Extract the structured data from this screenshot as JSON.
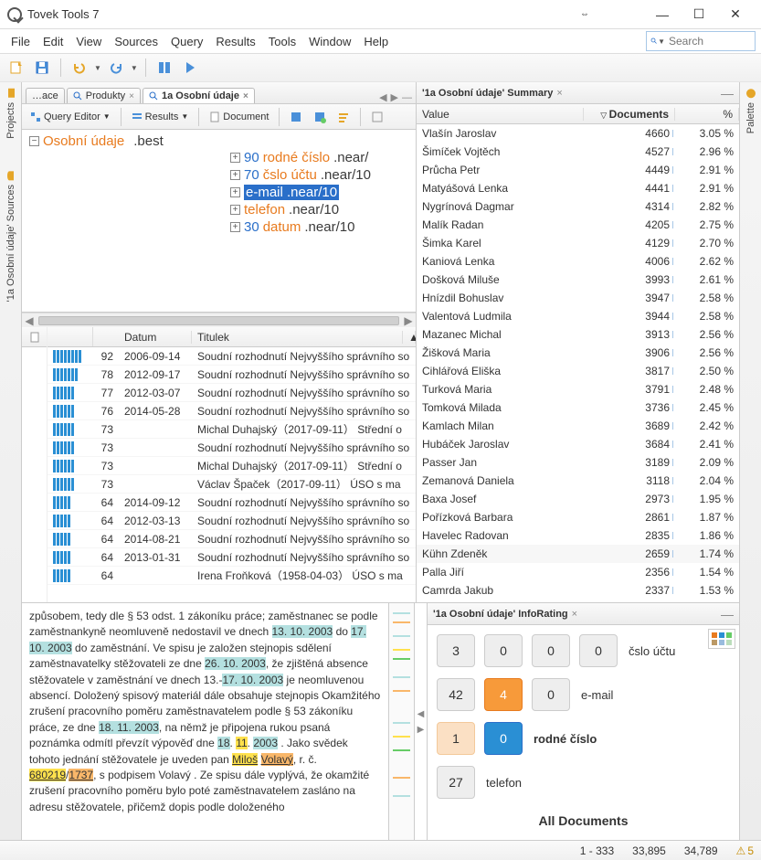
{
  "app": {
    "title": "Tovek Tools 7"
  },
  "menu": {
    "file": "File",
    "edit": "Edit",
    "view": "View",
    "sources": "Sources",
    "query": "Query",
    "results": "Results",
    "tools": "Tools",
    "window": "Window",
    "help": "Help"
  },
  "search": {
    "placeholder": "Search"
  },
  "leftTabs": {
    "projects": "Projects",
    "sources": "'1a Osobní údaje' Sources"
  },
  "rightTabs": {
    "palette": "Palette"
  },
  "editorTabs": {
    "t1": "…ace",
    "t2": "Produkty",
    "t3": "1a Osobní údaje"
  },
  "queryTools": {
    "editor": "Query Editor",
    "results": "Results",
    "document": "Document"
  },
  "tree": {
    "root_l": "Osobní údaje",
    "root_op": ".best",
    "c1_n": "90",
    "c1_l": "rodné číslo",
    "c1_op": ".near/",
    "c2_n": "70",
    "c2_l": "čslo účtu",
    "c2_op": ".near/10",
    "c3_l": "e-mail .near/10",
    "c4_l": "telefon",
    "c4_op": ".near/10",
    "c5_n": "30",
    "c5_l": "datum",
    "c5_op": ".near/10"
  },
  "resultHeaders": {
    "date": "Datum",
    "title": "Titulek"
  },
  "results": [
    {
      "n": "92",
      "d": "2006-09-14",
      "t": "Soudní rozhodnutí Nejvyššího správního so"
    },
    {
      "n": "78",
      "d": "2012-09-17",
      "t": "Soudní rozhodnutí Nejvyššího správního so"
    },
    {
      "n": "77",
      "d": "2012-03-07",
      "t": "Soudní rozhodnutí Nejvyššího správního so"
    },
    {
      "n": "76",
      "d": "2014-05-28",
      "t": "Soudní rozhodnutí Nejvyššího správního so"
    },
    {
      "n": "73",
      "d": "",
      "t": "Michal Duhajský（2017-09-11） Střední o"
    },
    {
      "n": "73",
      "d": "",
      "t": "Soudní rozhodnutí Nejvyššího správního so"
    },
    {
      "n": "73",
      "d": "",
      "t": "Michal Duhajský（2017-09-11） Střední o"
    },
    {
      "n": "73",
      "d": "",
      "t": "Václav Špaček（2017-09-11） ÚSO s ma"
    },
    {
      "n": "64",
      "d": "2014-09-12",
      "t": "Soudní rozhodnutí Nejvyššího správního so"
    },
    {
      "n": "64",
      "d": "2012-03-13",
      "t": "Soudní rozhodnutí Nejvyššího správního so"
    },
    {
      "n": "64",
      "d": "2014-08-21",
      "t": "Soudní rozhodnutí Nejvyššího správního so"
    },
    {
      "n": "64",
      "d": "2013-01-31",
      "t": "Soudní rozhodnutí Nejvyššího správního so"
    },
    {
      "n": "64",
      "d": "",
      "t": "Irena Froňková（1958-04-03） ÚSO s ma"
    }
  ],
  "summary": {
    "title": "'1a Osobní údaje' Summary",
    "headers": {
      "value": "Value",
      "documents": "Documents",
      "percent": "%"
    },
    "rows": [
      {
        "v": "Vlašín Jaroslav",
        "d": "4660",
        "p": "3.05 %"
      },
      {
        "v": "Šimíček Vojtěch",
        "d": "4527",
        "p": "2.96 %"
      },
      {
        "v": "Průcha Petr",
        "d": "4449",
        "p": "2.91 %"
      },
      {
        "v": "Matyášová Lenka",
        "d": "4441",
        "p": "2.91 %"
      },
      {
        "v": "Nygrínová Dagmar",
        "d": "4314",
        "p": "2.82 %"
      },
      {
        "v": "Malík Radan",
        "d": "4205",
        "p": "2.75 %"
      },
      {
        "v": "Šimka Karel",
        "d": "4129",
        "p": "2.70 %"
      },
      {
        "v": "Kaniová Lenka",
        "d": "4006",
        "p": "2.62 %"
      },
      {
        "v": "Došková Miluše",
        "d": "3993",
        "p": "2.61 %"
      },
      {
        "v": "Hnízdil Bohuslav",
        "d": "3947",
        "p": "2.58 %"
      },
      {
        "v": "Valentová Ludmila",
        "d": "3944",
        "p": "2.58 %"
      },
      {
        "v": "Mazanec Michal",
        "d": "3913",
        "p": "2.56 %"
      },
      {
        "v": "Žišková Maria",
        "d": "3906",
        "p": "2.56 %"
      },
      {
        "v": "Cihlářová Eliška",
        "d": "3817",
        "p": "2.50 %"
      },
      {
        "v": "Turková Maria",
        "d": "3791",
        "p": "2.48 %"
      },
      {
        "v": "Tomková Milada",
        "d": "3736",
        "p": "2.45 %"
      },
      {
        "v": "Kamlach Milan",
        "d": "3689",
        "p": "2.42 %"
      },
      {
        "v": "Hubáček Jaroslav",
        "d": "3684",
        "p": "2.41 %"
      },
      {
        "v": "Passer Jan",
        "d": "3189",
        "p": "2.09 %"
      },
      {
        "v": "Zemanová Daniela",
        "d": "3118",
        "p": "2.04 %"
      },
      {
        "v": "Baxa Josef",
        "d": "2973",
        "p": "1.95 %"
      },
      {
        "v": "Pořízková Barbara",
        "d": "2861",
        "p": "1.87 %"
      },
      {
        "v": "Havelec Radovan",
        "d": "2835",
        "p": "1.86 %"
      },
      {
        "v": "Kühn Zdeněk",
        "d": "2659",
        "p": "1.74 %"
      },
      {
        "v": "Palla Jiří",
        "d": "2356",
        "p": "1.54 %"
      },
      {
        "v": "Camrda Jakub",
        "d": "2337",
        "p": "1.53 %"
      }
    ]
  },
  "doc": {
    "parts": [
      {
        "t": "způsobem, tedy dle § 53 odst. 1 zákoníku práce; zaměstnanec se podle zaměstnankyně neomluveně nedostavil ve dnech "
      },
      {
        "t": "13. 10. 2003",
        "c": "cyan"
      },
      {
        "t": " do "
      },
      {
        "t": "17. 10. 2003",
        "c": "cyan"
      },
      {
        "t": " do zaměstnání. Ve spisu je založen stejnopis sdělení zaměstnavatelky stěžovateli ze dne "
      },
      {
        "t": "26. 10. 2003",
        "c": "cyan"
      },
      {
        "t": ", že zjištěná absence stěžovatele v zaměstnání ve dnech 13.-"
      },
      {
        "t": "17. 10. 2003",
        "c": "cyan"
      },
      {
        "t": " je neomluvenou absencí. Doložený spisový materiál dále obsahuje stejnopis Okamžitého zrušení pracovního  poměru zaměstnavatelem podle § 53 zákoníku práce, ze dne "
      },
      {
        "t": "18. 11. 2003",
        "c": "cyan"
      },
      {
        "t": ", na němž je připojena rukou psaná poznámka odmítl převzít výpověď dne "
      },
      {
        "t": "18",
        "c": "cyan"
      },
      {
        "t": ". "
      },
      {
        "t": "11",
        "c": "yel"
      },
      {
        "t": ". "
      },
      {
        "t": "2003",
        "c": "cyan"
      },
      {
        "t": " . Jako svědek tohoto jednání stěžovatele je uveden pan "
      },
      {
        "t": "Miloš",
        "c": "yel",
        "u": true
      },
      {
        "t": " "
      },
      {
        "t": "Volavý",
        "c": "or",
        "u": true
      },
      {
        "t": ", r. č. "
      },
      {
        "t": "680219",
        "c": "yel",
        "u": true
      },
      {
        "t": "/"
      },
      {
        "t": "1737",
        "c": "or",
        "u": true
      },
      {
        "t": ", s podpisem Volavý . Ze spisu dále vyplývá, že okamžité zrušení pracovního poměru bylo poté zaměstnavatelem zasláno na adresu stěžovatele, přičemž dopis podle doloženého"
      }
    ]
  },
  "info": {
    "title": "'1a Osobní údaje' InfoRating",
    "row1": {
      "a": "3",
      "b": "0",
      "c": "0",
      "d": "0",
      "label": "čslo účtu"
    },
    "row2": {
      "a": "42",
      "b": "4",
      "c": "0",
      "label": "e-mail"
    },
    "row3": {
      "a": "1",
      "b": "0",
      "label": "rodné číslo"
    },
    "row4": {
      "a": "27",
      "label": "telefon"
    },
    "all": "All Documents"
  },
  "status": {
    "range": "1 - 333",
    "total": "33,895",
    "filtered": "34,789",
    "warn": "5"
  }
}
